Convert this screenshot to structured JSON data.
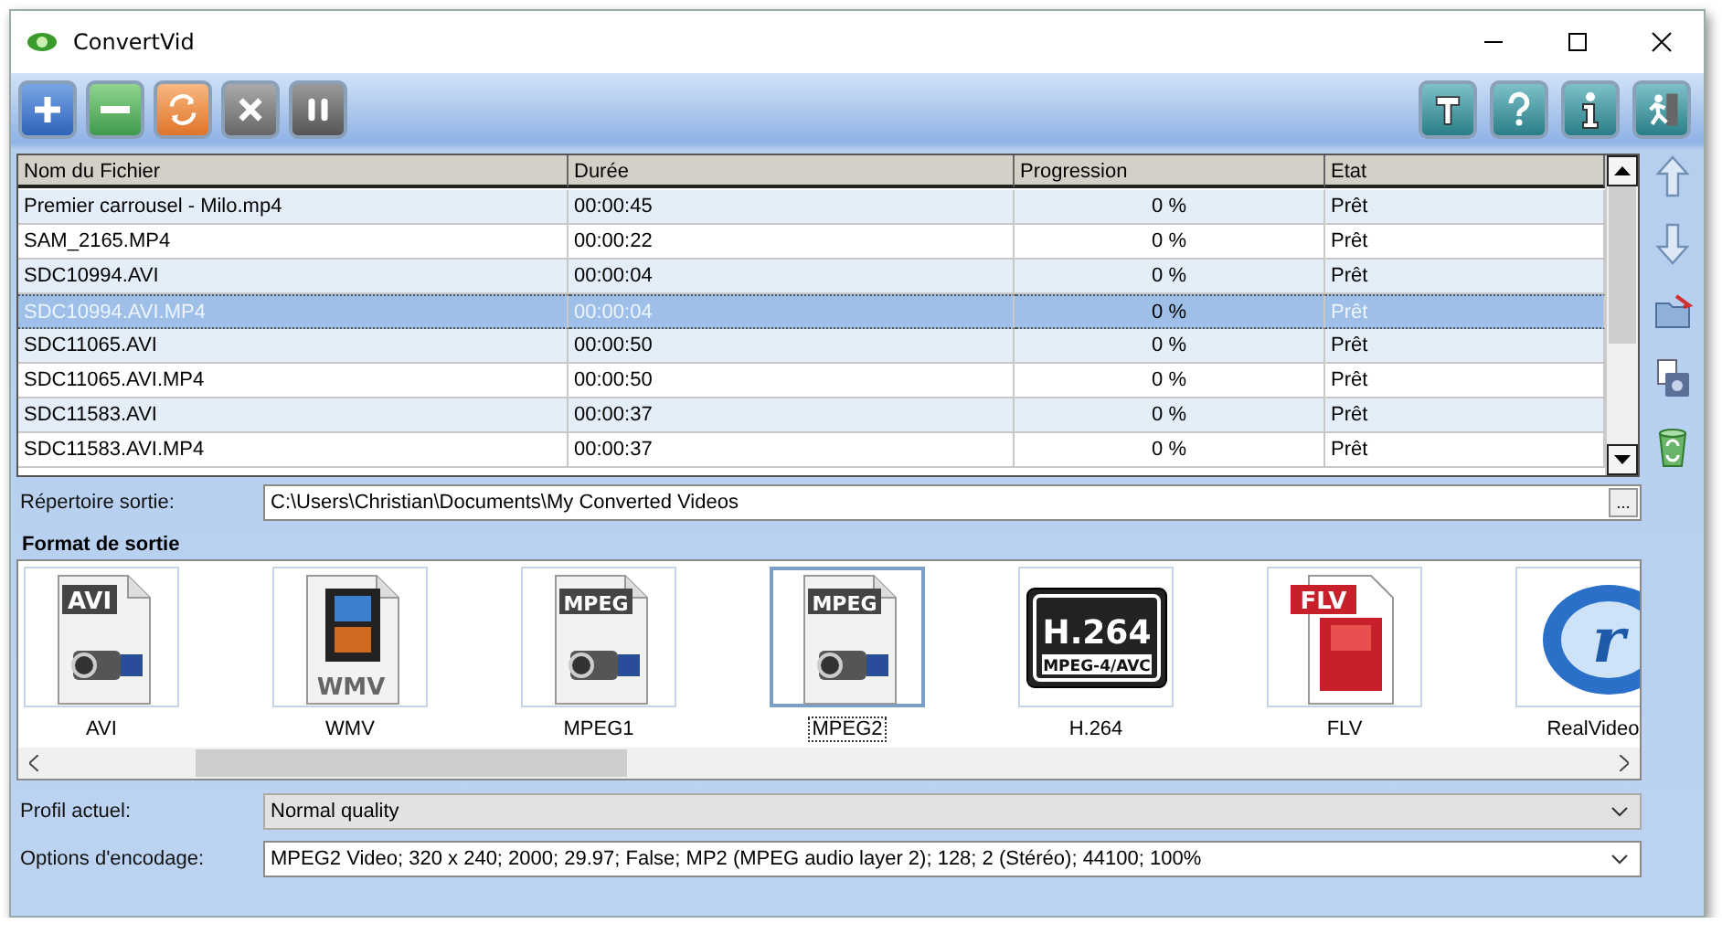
{
  "window": {
    "title": "ConvertVid"
  },
  "toolbar_left": [
    {
      "kind": "add"
    },
    {
      "kind": "remove"
    },
    {
      "kind": "convert"
    },
    {
      "kind": "cancel"
    },
    {
      "kind": "pause"
    }
  ],
  "toolbar_right": [
    {
      "kind": "tools"
    },
    {
      "kind": "help"
    },
    {
      "kind": "info"
    },
    {
      "kind": "exit"
    }
  ],
  "table": {
    "columns": [
      "Nom du Fichier",
      "Durée",
      "Progression",
      "Etat"
    ],
    "rows": [
      {
        "cells": [
          "Premier carrousel - Milo.mp4",
          "00:00:45",
          "0 %",
          "Prêt"
        ],
        "selected": false
      },
      {
        "cells": [
          "SAM_2165.MP4",
          "00:00:22",
          "0 %",
          "Prêt"
        ],
        "selected": false
      },
      {
        "cells": [
          "SDC10994.AVI",
          "00:00:04",
          "0 %",
          "Prêt"
        ],
        "selected": false
      },
      {
        "cells": [
          "SDC10994.AVI.MP4",
          "00:00:04",
          "0 %",
          "Prêt"
        ],
        "selected": true
      },
      {
        "cells": [
          "SDC11065.AVI",
          "00:00:50",
          "0 %",
          "Prêt"
        ],
        "selected": false
      },
      {
        "cells": [
          "SDC11065.AVI.MP4",
          "00:00:50",
          "0 %",
          "Prêt"
        ],
        "selected": false
      },
      {
        "cells": [
          "SDC11583.AVI",
          "00:00:37",
          "0 %",
          "Prêt"
        ],
        "selected": false
      },
      {
        "cells": [
          "SDC11583.AVI.MP4",
          "00:00:37",
          "0 %",
          "Prêt"
        ],
        "selected": false
      }
    ]
  },
  "side_buttons": [
    {
      "kind": "up"
    },
    {
      "kind": "down"
    },
    {
      "kind": "folder"
    },
    {
      "kind": "disk"
    },
    {
      "kind": "trash"
    }
  ],
  "output_dir": {
    "label": "Répertoire sortie:",
    "value": "C:\\Users\\Christian\\Documents\\My Converted Videos",
    "browse": "..."
  },
  "formats": {
    "title": "Format de sortie",
    "items": [
      {
        "kind": "avi",
        "badge": "AVI",
        "label": "AVI",
        "selected": false
      },
      {
        "kind": "wmv",
        "badge": "WMV",
        "label": "WMV",
        "selected": false
      },
      {
        "kind": "mpeg",
        "badge": "MPEG",
        "label": "MPEG1",
        "selected": false
      },
      {
        "kind": "mpeg",
        "badge": "MPEG",
        "label": "MPEG2",
        "selected": true
      },
      {
        "kind": "h264",
        "badge": "H.264",
        "sub_badge": "MPEG-4/AVC",
        "label": "H.264",
        "selected": false
      },
      {
        "kind": "flv",
        "badge": "FLV",
        "label": "FLV",
        "selected": false
      },
      {
        "kind": "real",
        "badge": "r",
        "label": "RealVideo",
        "selected": false
      }
    ]
  },
  "profile": {
    "label": "Profil actuel:",
    "value": "Normal quality"
  },
  "encoding": {
    "label": "Options d'encodage:",
    "value": "MPEG2 Video; 320 x 240; 2000; 29.97; False; MP2 (MPEG audio layer 2); 128; 2 (Stéréo); 44100; 100%"
  }
}
